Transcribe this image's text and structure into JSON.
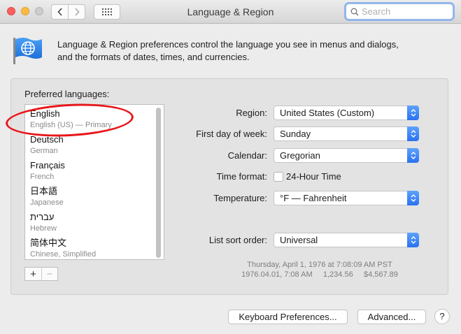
{
  "window": {
    "title": "Language & Region"
  },
  "search": {
    "placeholder": "Search"
  },
  "header": {
    "description_line1": "Language & Region preferences control the language you see in menus and dialogs,",
    "description_line2": "and the formats of dates, times, and currencies."
  },
  "languages": {
    "label": "Preferred languages:",
    "items": [
      {
        "name": "English",
        "sub": "English (US) — Primary"
      },
      {
        "name": "Deutsch",
        "sub": "German"
      },
      {
        "name": "Français",
        "sub": "French"
      },
      {
        "name": "日本語",
        "sub": "Japanese"
      },
      {
        "name": "עברית",
        "sub": "Hebrew"
      },
      {
        "name": "简体中文",
        "sub": "Chinese, Simplified"
      }
    ],
    "add_label": "+",
    "remove_label": "−"
  },
  "settings": {
    "region_label": "Region:",
    "region_value": "United States (Custom)",
    "first_day_label": "First day of week:",
    "first_day_value": "Sunday",
    "calendar_label": "Calendar:",
    "calendar_value": "Gregorian",
    "time_format_label": "Time format:",
    "time_format_option": "24-Hour Time",
    "temperature_label": "Temperature:",
    "temperature_value": "°F — Fahrenheit",
    "sort_label": "List sort order:",
    "sort_value": "Universal"
  },
  "sample": {
    "line1": "Thursday, April 1, 1976 at 7:08:09 AM PST",
    "line2": "1976.04.01, 7:08 AM     1,234.56     $4,567.89"
  },
  "buttons": {
    "keyboard": "Keyboard Preferences...",
    "advanced": "Advanced...",
    "help": "?"
  },
  "colors": {
    "annotation": "#e8161a",
    "accent": "#2a71f0"
  }
}
